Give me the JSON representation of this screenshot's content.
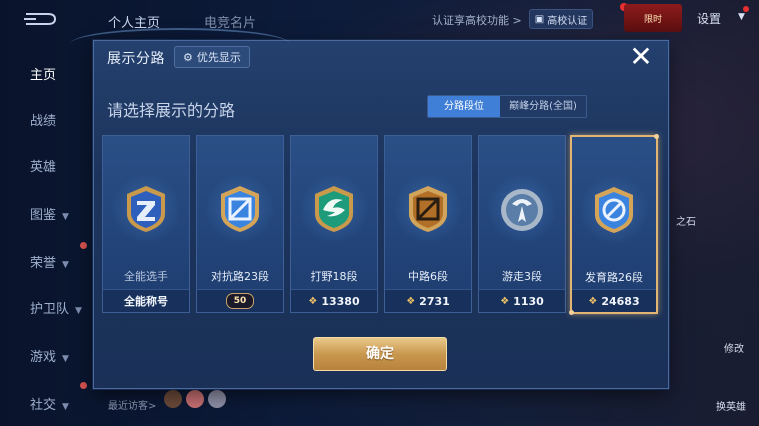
{
  "topbar": {
    "tabs": [
      "个人主页",
      "电竞名片"
    ],
    "cert_link": "认证享高校功能 >",
    "cert_badge": "高校认证",
    "promo": "限时",
    "settings": "设置",
    "logo_icon": "app-logo-icon"
  },
  "sidebar": {
    "items": [
      {
        "label": "主页",
        "active": true
      },
      {
        "label": "战绩"
      },
      {
        "label": "英雄"
      },
      {
        "label": "图鉴",
        "chevron": true
      },
      {
        "label": "荣誉",
        "chevron": true
      },
      {
        "label": "护卫队",
        "chevron": true
      },
      {
        "label": "游戏",
        "chevron": true
      },
      {
        "label": "社交",
        "chevron": true
      }
    ],
    "recent_label": "最近访客>"
  },
  "right": {
    "mid_label": "之石",
    "bottom_label": "换英雄",
    "upper_label": "修改"
  },
  "modal": {
    "title": "展示分路",
    "priority_label": "优先显示",
    "subtitle": "请选择展示的分路",
    "segments": [
      {
        "label": "分路段位",
        "active": true
      },
      {
        "label": "巅峰分路(全国)",
        "active": false
      }
    ],
    "cards": [
      {
        "label": "全能选手",
        "footer": "全能称号",
        "footer_type": "text",
        "icon": "all-round-emblem-icon",
        "color": "#3a73d9"
      },
      {
        "label": "对抗路23段",
        "footer": "50",
        "footer_type": "badge",
        "icon": "clash-lane-emblem-icon",
        "color": "#3c86e0"
      },
      {
        "label": "打野18段",
        "footer": "13380",
        "footer_type": "score",
        "icon": "jungle-emblem-icon",
        "color": "#1f9a7c"
      },
      {
        "label": "中路6段",
        "footer": "2731",
        "footer_type": "score",
        "icon": "mid-lane-emblem-icon",
        "color": "#b8772e"
      },
      {
        "label": "游走3段",
        "footer": "1130",
        "footer_type": "score",
        "icon": "roam-emblem-icon",
        "color": "#8ea6c4"
      },
      {
        "label": "发育路26段",
        "footer": "24683",
        "footer_type": "score",
        "icon": "farm-lane-emblem-icon",
        "color": "#3c86e0",
        "selected": true
      }
    ],
    "confirm_label": "确定"
  },
  "colors": {
    "accent_gold": "#e3b574",
    "segment_active": "#3f7fd7",
    "modal_bg": "#1c345c"
  }
}
